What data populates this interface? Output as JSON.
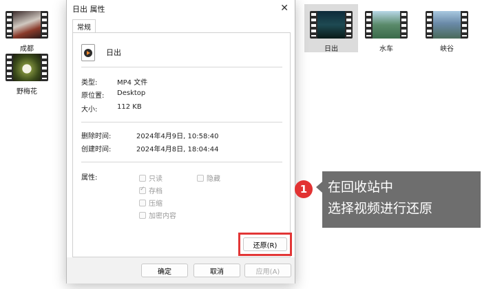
{
  "desktop": {
    "thumbnails": [
      {
        "label": "成都"
      },
      {
        "label": "野梅花"
      },
      {
        "label": "日出"
      },
      {
        "label": "水车"
      },
      {
        "label": "峡谷"
      }
    ]
  },
  "dialog": {
    "title": "日出 属性",
    "close_icon": "close-icon",
    "tab": "常规",
    "file_name": "日出",
    "file_icon": "video-file-icon",
    "type_label": "类型:",
    "type_value": "MP4 文件",
    "location_label": "原位置:",
    "location_value": "Desktop",
    "size_label": "大小:",
    "size_value": "112 KB",
    "deleted_label": "删除时间:",
    "deleted_value": "2024年4月9日, 10:58:40",
    "created_label": "创建时间:",
    "created_value": "2024年4月8日, 18:04:44",
    "attributes_label": "属性:",
    "attributes": {
      "readonly": "只读",
      "hidden": "隐藏",
      "archive": "存档",
      "compress": "压缩",
      "encrypt": "加密内容"
    },
    "restore_button": "还原(R)",
    "ok_button": "确定",
    "cancel_button": "取消",
    "apply_button": "应用(A)"
  },
  "callout": {
    "step": "1",
    "line1": "在回收站中",
    "line2": "选择视频进行还原"
  },
  "colors": {
    "highlight": "#e23636",
    "callout_bg": "#6e6e6e"
  }
}
